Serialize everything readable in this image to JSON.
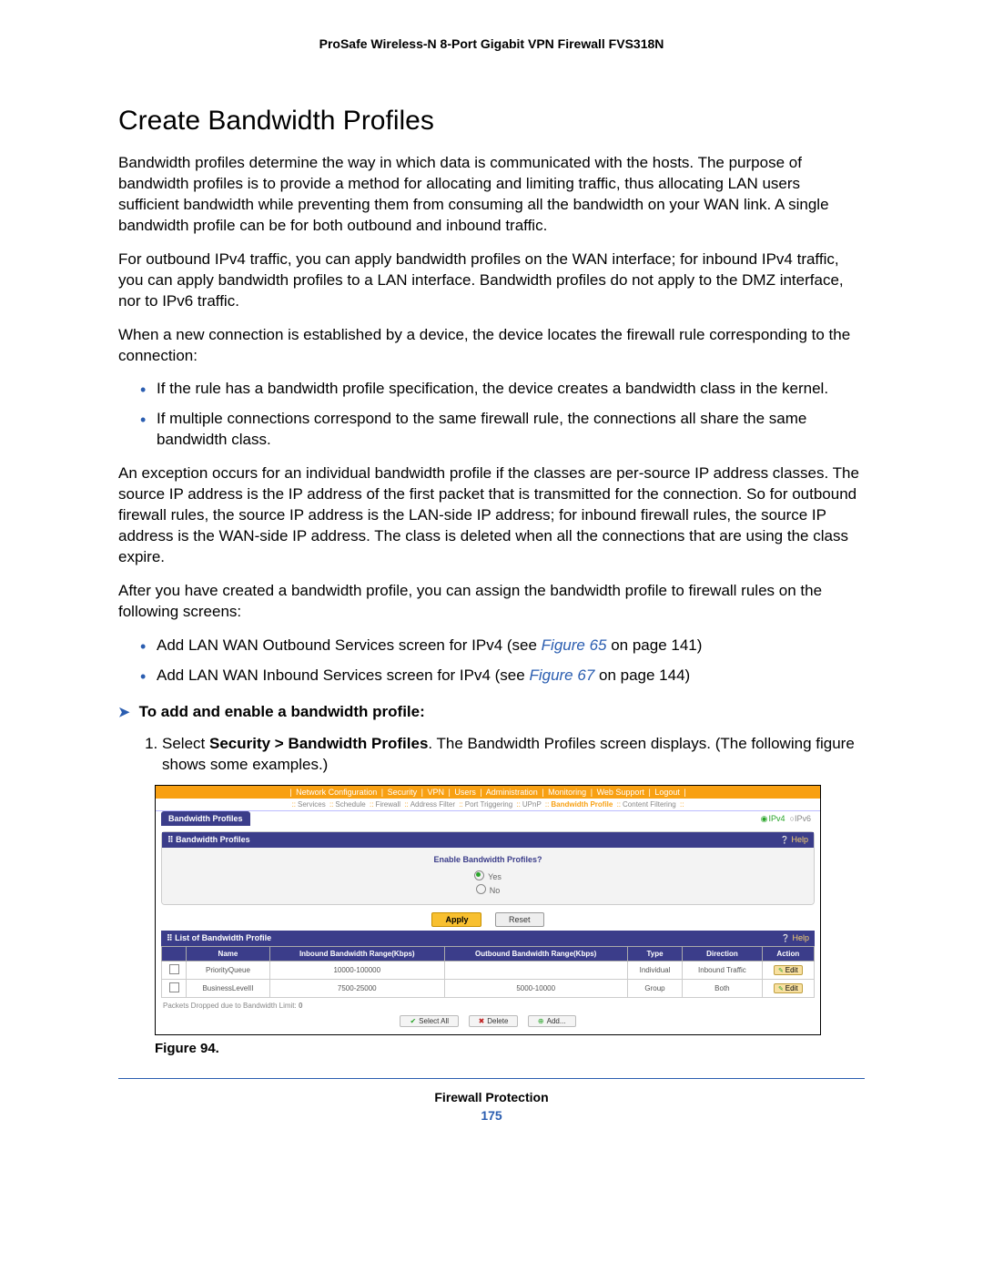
{
  "header": "ProSafe Wireless-N 8-Port Gigabit VPN Firewall FVS318N",
  "title": "Create Bandwidth Profiles",
  "p1": "Bandwidth profiles determine the way in which data is communicated with the hosts. The purpose of bandwidth profiles is to provide a method for allocating and limiting traffic, thus allocating LAN users sufficient bandwidth while preventing them from consuming all the bandwidth on your WAN link. A single bandwidth profile can be for both outbound and inbound traffic.",
  "p2": "For outbound IPv4 traffic, you can apply bandwidth profiles on the WAN interface; for inbound IPv4 traffic, you can apply bandwidth profiles to a LAN interface. Bandwidth profiles do not apply to the DMZ interface, nor to IPv6 traffic.",
  "p3": "When a new connection is established by a device, the device locates the firewall rule corresponding to the connection:",
  "b1": "If the rule has a bandwidth profile specification, the device creates a bandwidth class in the kernel.",
  "b2": "If multiple connections correspond to the same firewall rule, the connections all share the same bandwidth class.",
  "p4": "An exception occurs for an individual bandwidth profile if the classes are per-source IP address classes. The source IP address is the IP address of the first packet that is transmitted for the connection. So for outbound firewall rules, the source IP address is the LAN-side IP address; for inbound firewall rules, the source IP address is the WAN-side IP address. The class is deleted when all the connections that are using the class expire.",
  "p5": "After you have created a bandwidth profile, you can assign the bandwidth profile to firewall rules on the following screens:",
  "b3a": "Add LAN WAN Outbound Services screen for IPv4 (see ",
  "b3link": "Figure 65",
  "b3b": " on page 141)",
  "b4a": "Add LAN WAN Inbound Services screen for IPv4 (see ",
  "b4link": "Figure 67",
  "b4b": " on page 144)",
  "proc_head": "To add and enable a bandwidth profile:",
  "step1a": "Select ",
  "step1b": "Security > Bandwidth Profiles",
  "step1c": ". The Bandwidth Profiles screen displays. (The following figure shows some examples.)",
  "fig": {
    "nav1": [
      "Network Configuration",
      "Security",
      "VPN",
      "Users",
      "Administration",
      "Monitoring",
      "Web Support",
      "Logout"
    ],
    "nav2": [
      "Services",
      "Schedule",
      "Firewall",
      "Address Filter",
      "Port Triggering",
      "UPnP",
      "Bandwidth Profile",
      "Content Filtering"
    ],
    "tab": "Bandwidth Profiles",
    "ipv4": "IPv4",
    "ipv6": "IPv6",
    "panel1_title": "Bandwidth Profiles",
    "help": "Help",
    "enable_q": "Enable Bandwidth Profiles?",
    "yes": "Yes",
    "no": "No",
    "apply": "Apply",
    "reset": "Reset",
    "panel2_title": "List of Bandwidth Profile",
    "cols": {
      "c1": "Name",
      "c2": "Inbound Bandwidth Range(Kbps)",
      "c3": "Outbound Bandwidth Range(Kbps)",
      "c4": "Type",
      "c5": "Direction",
      "c6": "Action"
    },
    "rows": [
      {
        "name": "PriorityQueue",
        "in": "10000-100000",
        "out": "",
        "type": "Individual",
        "dir": "Inbound Traffic",
        "act": "Edit"
      },
      {
        "name": "BusinessLevelII",
        "in": "7500-25000",
        "out": "5000-10000",
        "type": "Group",
        "dir": "Both",
        "act": "Edit"
      }
    ],
    "drop_note_a": "Packets Dropped due to Bandwidth Limit: ",
    "drop_note_b": "0",
    "selall": "Select All",
    "delete": "Delete",
    "add": "Add..."
  },
  "fig_caption": "Figure 94.",
  "footer_title": "Firewall Protection",
  "page_num": "175"
}
